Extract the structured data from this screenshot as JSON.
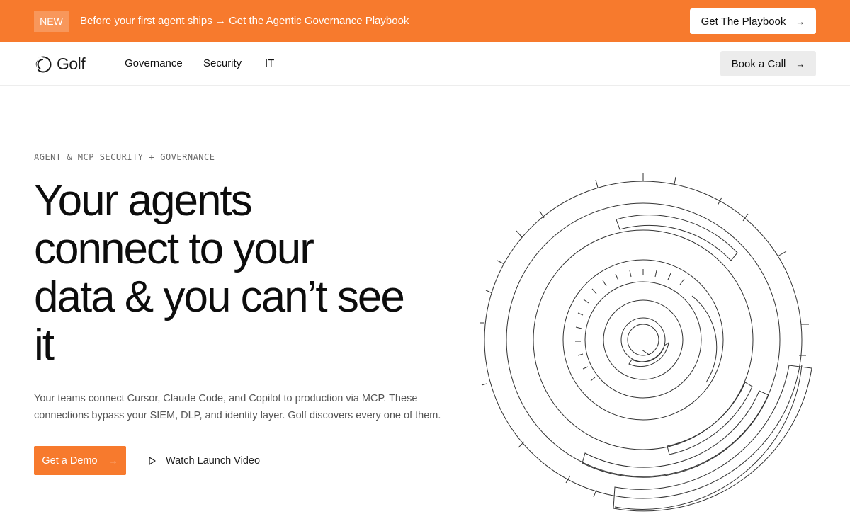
{
  "announcement": {
    "badge": "NEW",
    "message": "Before your first agent ships → Get the Agentic Governance Playbook",
    "cta_label": "Get The Playbook"
  },
  "nav": {
    "logo_text": "Golf",
    "links": [
      "Governance",
      "Security",
      "IT"
    ],
    "cta_label": "Book a Call"
  },
  "hero": {
    "eyebrow_left": "AGENT & MCP SECURITY",
    "eyebrow_sep": "+",
    "eyebrow_right": "GOVERNANCE",
    "headline_lines": [
      "Your agents",
      "connect to your",
      "data & you can’t see",
      "it"
    ],
    "subtext_lines": [
      "Your teams connect Cursor, Claude Code, and Copilot to production via MCP. These",
      "connections bypass your SIEM, DLP, and identity layer. Golf discovers every one of them."
    ],
    "primary_cta": "Get a Demo",
    "secondary_cta": "Watch Launch Video"
  },
  "icons": {
    "arrow": "arrow-right-icon",
    "play": "play-icon",
    "logo": "golf-logo-icon"
  },
  "colors": {
    "brand_orange": "#f77a2d",
    "text_dark": "#111111",
    "button_gray": "#ececec"
  }
}
